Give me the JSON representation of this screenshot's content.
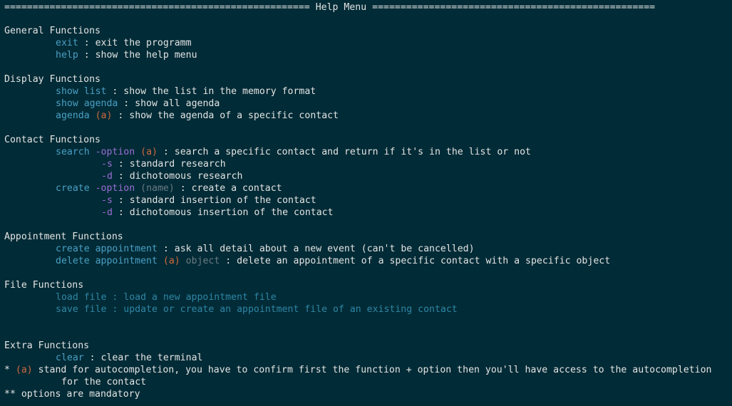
{
  "header": {
    "left_rule": "======================================================",
    "title": "Help Menu",
    "right_rule": "=================================================="
  },
  "general": {
    "title": "General Functions",
    "exit": {
      "cmd": "exit",
      "sep": " : ",
      "desc": "exit the programm"
    },
    "help": {
      "cmd": "help",
      "sep": " : ",
      "desc": "show the help menu"
    }
  },
  "display": {
    "title": "Display Functions",
    "show_list": {
      "cmd": "show list",
      "sep": " : ",
      "desc": "show the list in the memory format"
    },
    "show_agenda": {
      "cmd": "show agenda",
      "sep": " : ",
      "desc": "show all agenda"
    },
    "agenda": {
      "cmd": "agenda",
      "arg": "(a)",
      "sep": " : ",
      "desc": "show the agenda of a specific contact"
    }
  },
  "contact": {
    "title": "Contact Functions",
    "search": {
      "cmd": "search",
      "opt": "-option",
      "arg": "(a)",
      "sep": " : ",
      "desc": "search a specific contact and return if it's in the list or not",
      "s_flag": "-s",
      "s_desc": " : standard research",
      "d_flag": "-d",
      "d_desc": " : dichotomous research"
    },
    "create": {
      "cmd": "create",
      "opt": "-option",
      "arg": "(name)",
      "sep": " : ",
      "desc": "create a contact",
      "s_flag": "-s",
      "s_desc": " : standard insertion of the contact",
      "d_flag": "-d",
      "d_desc": " : dichotomous insertion of the contact"
    }
  },
  "appointment": {
    "title": "Appointment Functions",
    "create": {
      "cmd": "create appointment",
      "sep": " : ",
      "desc": "ask all detail about a new event (can't be cancelled)"
    },
    "delete": {
      "cmd": "delete appointment",
      "arg": "(a)",
      "obj": "object",
      "sep": " : ",
      "desc": "delete an appointment of a specific contact with a specific object"
    }
  },
  "file": {
    "title": "File Functions",
    "load": "load file : load a new appointment file",
    "save": "save file : update or create an appointment file of an existing contact"
  },
  "extra": {
    "title": "Extra Functions",
    "clear": {
      "cmd": "clear",
      "sep": " : ",
      "desc": "clear the terminal"
    }
  },
  "notes": {
    "star": "* ",
    "arg": "(a)",
    "line1": " stand for autocompletion, you have to confirm first the function + option then you'll have access to the autocompletion",
    "line2": "for the contact",
    "line3": "** options are mandatory"
  },
  "colors": {
    "background": "#012b36",
    "text": "#e4e4e4",
    "command": "#4aa0c6",
    "option": "#9a6fd6",
    "argument": "#d26a3e",
    "dim": "#6b7c84",
    "file": "#2f86a6"
  }
}
